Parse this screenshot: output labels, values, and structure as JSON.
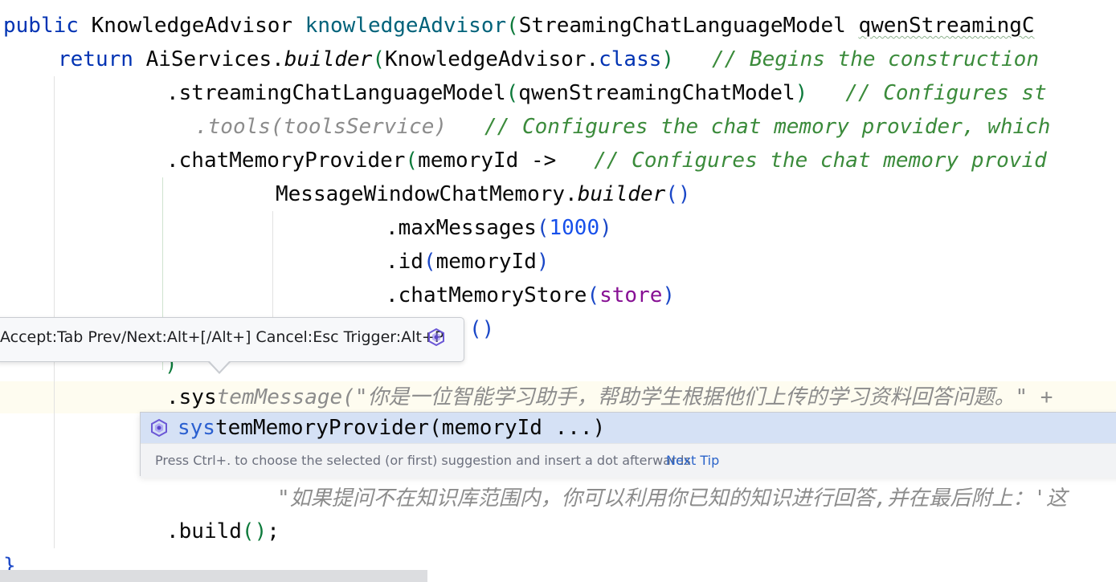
{
  "code": {
    "l1": {
      "kw": "public",
      "type": " KnowledgeAdvisor ",
      "method": "knowledgeAdvisor",
      "open": "(",
      "ptype": "StreamingChatLanguageModel ",
      "pname": "qwenStreamingC"
    },
    "l2": {
      "kw": "return",
      "cls": " AiServices.",
      "call": "builder",
      "open": "(",
      "arg": "KnowledgeAdvisor.",
      "arg_kw": "class",
      "close": ")",
      "comment": "   // Begins the construction"
    },
    "l3": {
      "call": ".streamingChatLanguageModel",
      "open": "(",
      "arg": "qwenStreamingChatModel",
      "close": ")",
      "comment": "   // Configures st"
    },
    "l4": {
      "text": ".tools(toolsService)",
      "comment": "   // Configures the chat memory provider, which"
    },
    "l5": {
      "call": ".chatMemoryProvider",
      "open": "(",
      "arg": "memoryId ->",
      "comment": "   // Configures the chat memory provid"
    },
    "l6": {
      "cls": "MessageWindowChatMemory.",
      "call": "builder",
      "parens": "()"
    },
    "l7": {
      "call": ".maxMessages",
      "open": "(",
      "num": "1000",
      "close": ")"
    },
    "l8": {
      "call": ".id",
      "open": "(",
      "arg": "memoryId",
      "close": ")"
    },
    "l9": {
      "call": ".chatMemoryStore",
      "open": "(",
      "arg": "store",
      "close": ")"
    },
    "l10": {
      "parens": "()"
    },
    "l11": {
      "close": ")"
    },
    "l12": {
      "typed": ".sys",
      "ghost": "temMessage(",
      "str": "\"你是一位智能学习助手，帮助学生根据他们上传的学习资料回答问题。\" +"
    },
    "l13": {
      "str": "\"如果提问不在知识库范围内，你可以利用你已知的知识进行回答,并在最后附上：'这"
    },
    "l14": {
      "text": ".build",
      "parens": "()",
      "semi": ";"
    },
    "l15": {
      "text": "}"
    }
  },
  "tooltip": {
    "text": "Accept:Tab Prev/Next:Alt+[/Alt+] Cancel:Esc Trigger:Alt+P",
    "icon": "ai-assistant-icon"
  },
  "completion": {
    "icon": "ai-assistant-icon",
    "match": "sys",
    "rest": "temMemoryProvider(memoryId ...)",
    "hint": "Press Ctrl+. to choose the selected (or first) suggestion and insert a dot afterwards",
    "next_tip": "Next Tip"
  }
}
